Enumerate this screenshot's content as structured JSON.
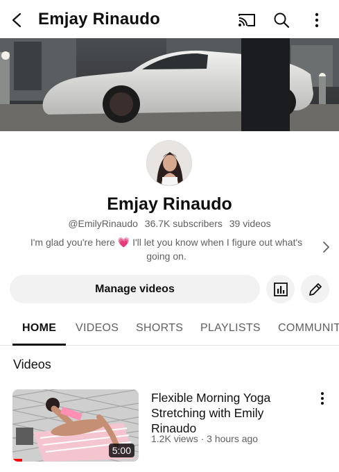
{
  "header": {
    "title": "Emjay Rinaudo",
    "icons": [
      "back-arrow-icon",
      "cast-icon",
      "search-icon",
      "more-vert-icon"
    ]
  },
  "channel": {
    "name": "Emjay Rinaudo",
    "handle": "@EmilyRinaudo",
    "subscribers": "36.7K subscribers",
    "videos": "39 videos",
    "description_line1": "I'm glad you're here 💗 I'll let you know when I figure out what's",
    "description_line2": "going on."
  },
  "actions": {
    "manage_label": "Manage videos",
    "icons": [
      "analytics-icon",
      "edit-pencil-icon"
    ]
  },
  "tabs": [
    {
      "label": "HOME",
      "active": true
    },
    {
      "label": "VIDEOS",
      "active": false
    },
    {
      "label": "SHORTS",
      "active": false
    },
    {
      "label": "PLAYLISTS",
      "active": false
    },
    {
      "label": "COMMUNITY",
      "active": false
    }
  ],
  "section": {
    "title": "Videos"
  },
  "video": {
    "title": "Flexible Morning Yoga Stretching with Emily Rinaudo",
    "views": "1.2K views",
    "age": "3 hours ago",
    "meta": "1.2K views · 3 hours ago",
    "duration": "5:00"
  },
  "colors": {
    "text": "#0f0f0f",
    "secondary": "#606060",
    "chip_bg": "#f2f2f2",
    "progress": "#ff0000"
  }
}
